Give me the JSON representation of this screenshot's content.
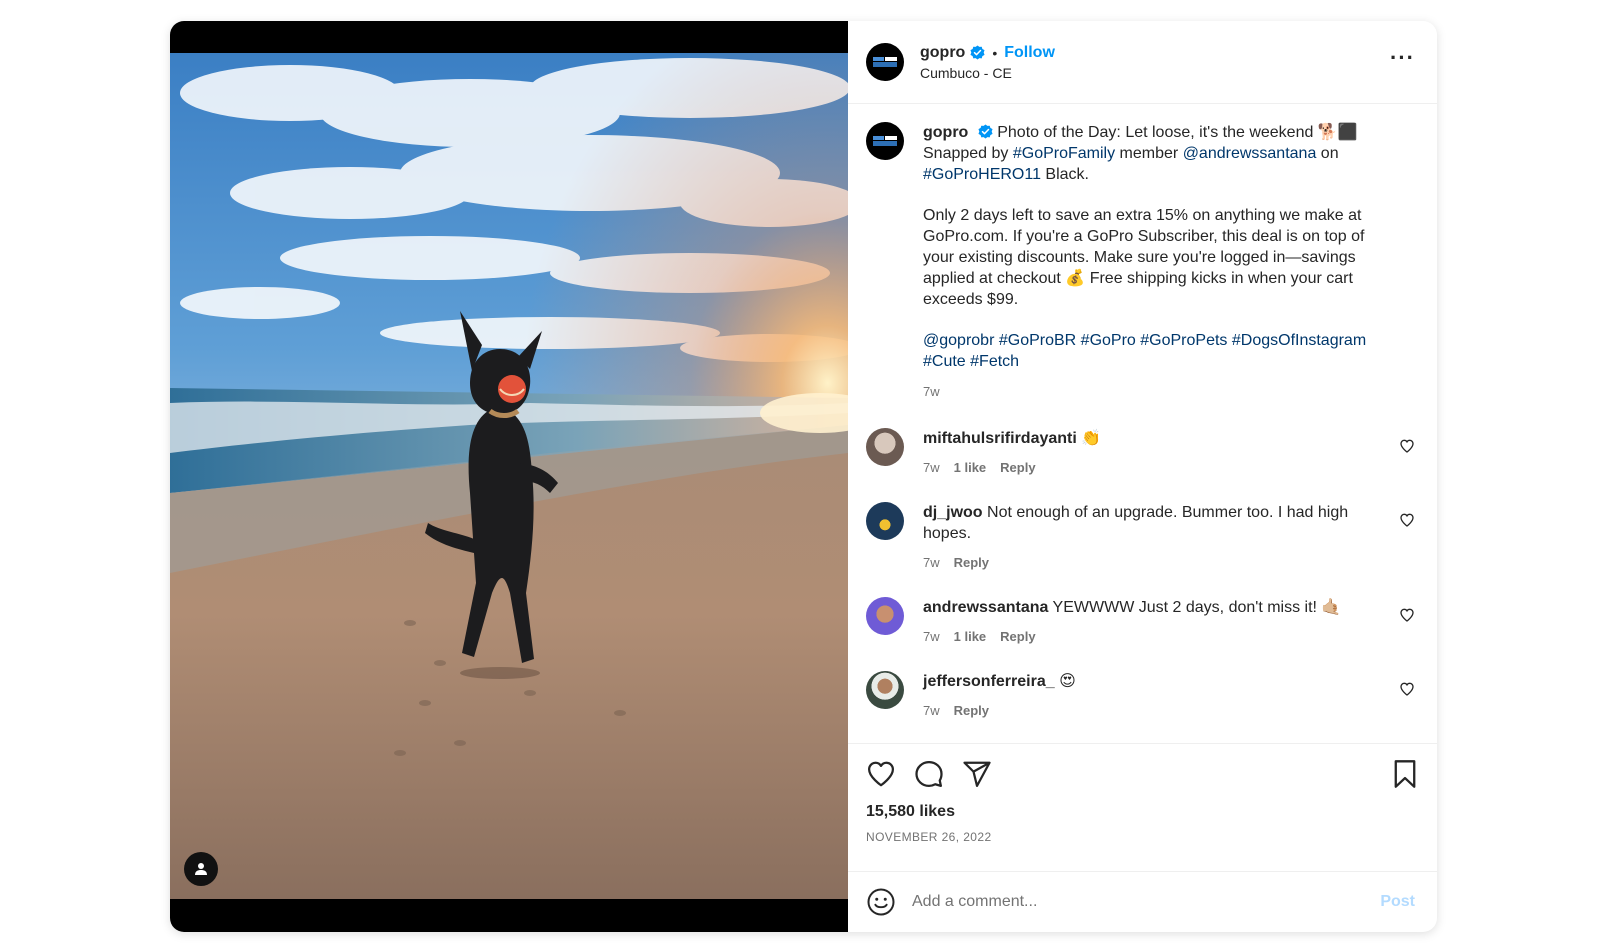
{
  "colors": {
    "accent": "#0095f6",
    "link": "#00376b",
    "muted": "#737373",
    "post_disabled": "#b3dbff"
  },
  "header": {
    "username": "gopro",
    "verified": true,
    "separator": "•",
    "follow_label": "Follow",
    "location": "Cumbuco - CE",
    "more_icon": "more-horizontal-icon"
  },
  "caption": {
    "username": "gopro",
    "line1_text": "Photo of the Day: Let loose, it's the weekend 🐕‍⬛",
    "line2_prefix": "Snapped by ",
    "tag_family": "#GoProFamily",
    "line2_mid": " member ",
    "mention_santana": "@andrewssantana",
    "line2_suffix": " on",
    "tag_hero": "#GoProHERO11",
    "line3_suffix": " Black.",
    "paragraph2": "Only 2 days left to save an extra 15% on anything we make at GoPro.com. If you're a GoPro Subscriber, this deal is on top of your existing discounts. Make sure you're logged in—savings applied at checkout 💰 Free shipping kicks in when your cart exceeds $99.",
    "hashtags": [
      "@goprobr",
      "#GoProBR",
      "#GoPro",
      "#GoProPets",
      "#DogsOfInstagram",
      "#Cute",
      "#Fetch"
    ],
    "time": "7w"
  },
  "comments": [
    {
      "username": "miftahulsrifirdayanti",
      "text": "👏",
      "time": "7w",
      "likes": "1 like",
      "reply": "Reply"
    },
    {
      "username": "dj_jwoo",
      "text": "Not enough of an upgrade. Bummer too. I had high hopes.",
      "time": "7w",
      "likes": "",
      "reply": "Reply"
    },
    {
      "username": "andrewssantana",
      "text": "YEWWWW Just 2 days, don't miss it! 🤙🏼",
      "time": "7w",
      "likes": "1 like",
      "reply": "Reply"
    },
    {
      "username": "jeffersonferreira_",
      "text": "😍",
      "time": "7w",
      "likes": "",
      "reply": "Reply"
    }
  ],
  "actions": {
    "like_icon": "heart-icon",
    "comment_icon": "comment-icon",
    "share_icon": "share-icon",
    "save_icon": "bookmark-icon",
    "likes_text": "15,580 likes",
    "date": "NOVEMBER 26, 2022"
  },
  "add_comment": {
    "placeholder": "Add a comment...",
    "post_label": "Post"
  }
}
